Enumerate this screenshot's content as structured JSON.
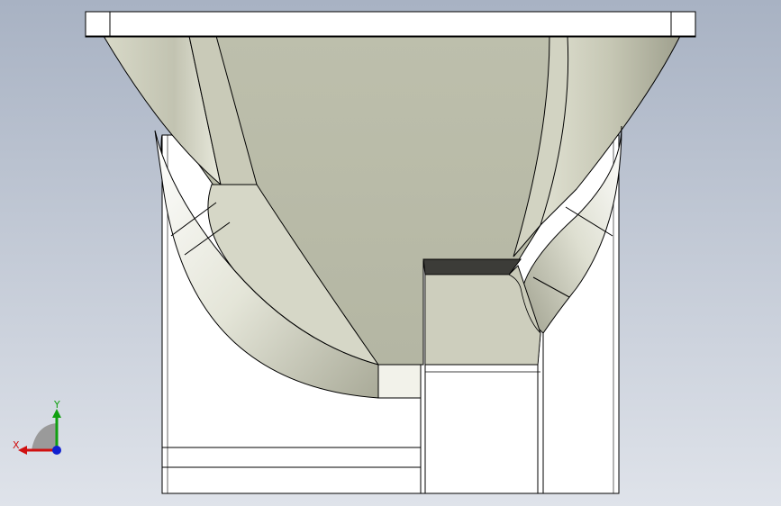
{
  "viewport": {
    "background_top": "#a8b2c3",
    "background_bottom": "#dfe3ea"
  },
  "model": {
    "stroke_color": "#000000",
    "face_white": "#ffffff",
    "face_light": "#f4f4ee",
    "face_mid": "#c8c9b8",
    "face_dark": "#9c9d8a",
    "face_inner": "#b9bba9",
    "face_shadow": "#3c3c38"
  },
  "triad": {
    "x_label": "X",
    "y_label": "Y",
    "x_color": "#d01010",
    "y_color": "#10a010",
    "z_color": "#1020d0",
    "origin_color": "#9a9a9a"
  }
}
